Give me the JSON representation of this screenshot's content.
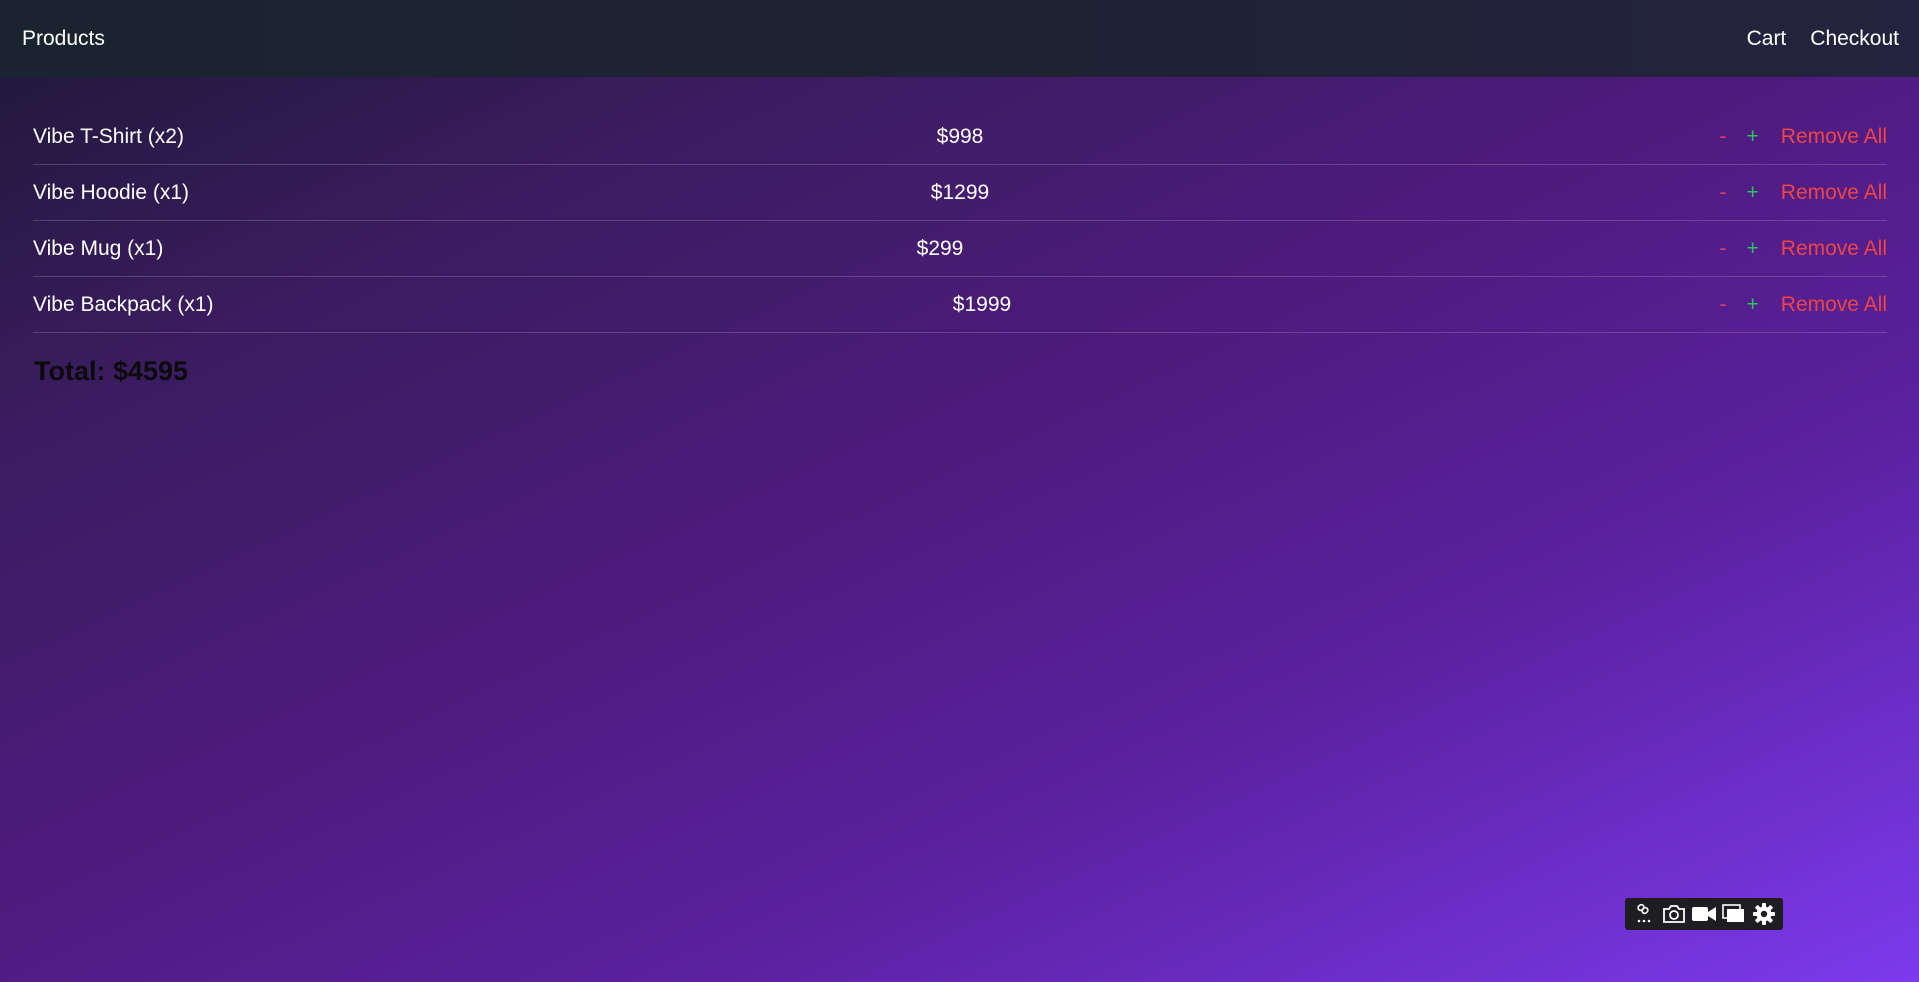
{
  "nav": {
    "products_label": "Products",
    "cart_label": "Cart",
    "checkout_label": "Checkout"
  },
  "cart": {
    "items": [
      {
        "name": "Vibe T-Shirt (x2)",
        "price": "$998",
        "minus": "-",
        "plus": "+",
        "remove": "Remove All"
      },
      {
        "name": "Vibe Hoodie (x1)",
        "price": "$1299",
        "minus": "-",
        "plus": "+",
        "remove": "Remove All"
      },
      {
        "name": "Vibe Mug (x1)",
        "price": "$299",
        "minus": "-",
        "plus": "+",
        "remove": "Remove All"
      },
      {
        "name": "Vibe Backpack (x1)",
        "price": "$1999",
        "minus": "-",
        "plus": "+",
        "remove": "Remove All"
      }
    ],
    "total": "Total: $4595"
  },
  "toolbar": {
    "icons": [
      "link-icon",
      "camera-icon",
      "video-icon",
      "window-icon",
      "gear-icon"
    ]
  },
  "colors": {
    "minus": "#e53e5c",
    "plus": "#22c55e",
    "remove": "#ef4444",
    "gradient_start": "#1c1836",
    "gradient_end": "#7c3aed"
  }
}
